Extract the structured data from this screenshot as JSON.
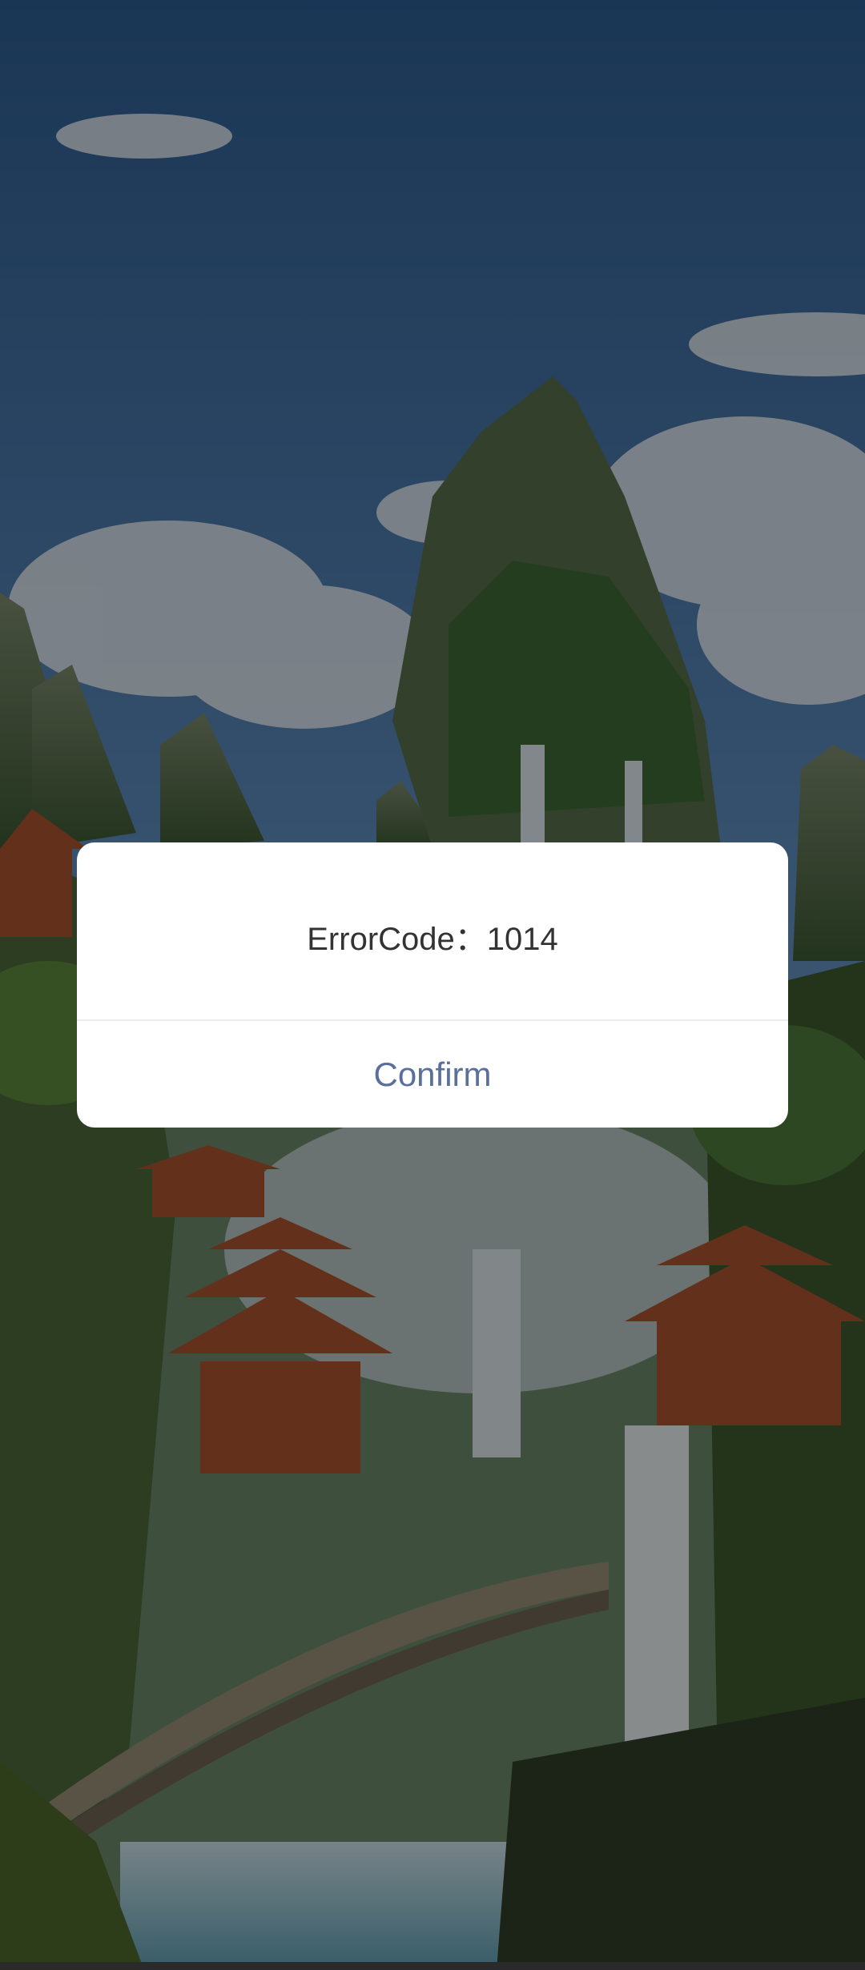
{
  "dialog": {
    "message": "ErrorCode：1014",
    "confirm_label": "Confirm"
  },
  "background": {
    "scene": "illustrated-mountain-temple-waterfall-landscape"
  },
  "colors": {
    "confirm_text": "#5b6f9c",
    "message_text": "#333333",
    "dialog_bg": "#ffffff",
    "overlay": "rgba(0,0,0,0.42)"
  }
}
